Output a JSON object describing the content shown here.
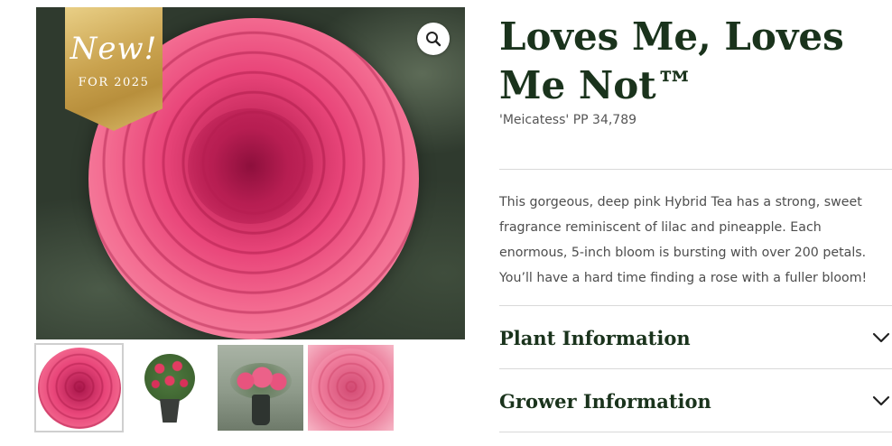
{
  "gallery": {
    "badge": {
      "title": "New!",
      "subtitle": "FOR 2025"
    },
    "zoom_icon": "magnifier-icon",
    "main_image": "deep pink rose bloom",
    "thumbnails": [
      {
        "name": "rose-bloom-closeup"
      },
      {
        "name": "rose-bush-in-pot"
      },
      {
        "name": "rose-bouquet-in-vase"
      },
      {
        "name": "rose-bloom-soft-closeup"
      }
    ]
  },
  "product": {
    "title": "Loves Me, Loves Me Not™",
    "cultivar": "'Meicatess' PP 34,789",
    "description": "This gorgeous, deep pink Hybrid Tea has a strong, sweet fragrance reminiscent of lilac and pineapple. Each enormous, 5-inch bloom is bursting with over 200 petals. You’ll have a hard time finding a rose with a fuller bloom!"
  },
  "accordions": [
    {
      "label": "Plant Information",
      "icon": "chevron-down-icon"
    },
    {
      "label": "Grower Information",
      "icon": "chevron-down-icon"
    }
  ],
  "colors": {
    "heading": "#1a331c",
    "badge_gold": "#c9a24e",
    "rose_pink": "#e9467a"
  }
}
